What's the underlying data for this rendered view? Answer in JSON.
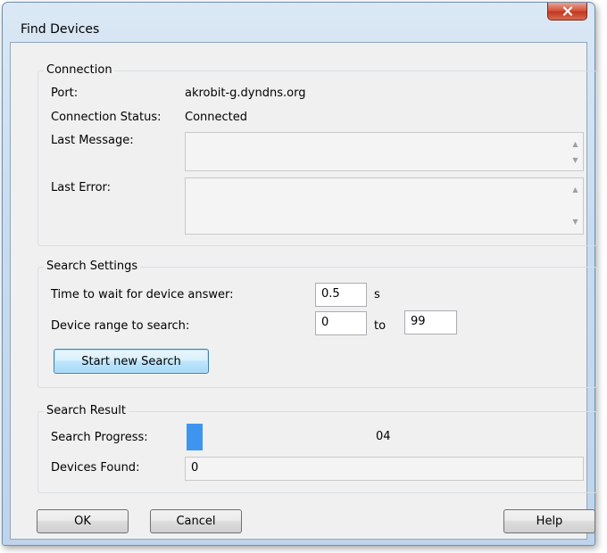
{
  "window": {
    "title": "Find Devices",
    "close_icon": "close-icon",
    "close_glyph": "X",
    "close_color": "#c2381f"
  },
  "connection": {
    "group_title": "Connection",
    "port_label": "Port:",
    "port_value": "akrobit-g.dyndns.org",
    "status_label": "Connection Status:",
    "status_value": "Connected",
    "last_message_label": "Last Message:",
    "last_message_value": "",
    "last_error_label": "Last Error:",
    "last_error_value": ""
  },
  "search_settings": {
    "group_title": "Search Settings",
    "wait_label": "Time to wait for device answer:",
    "wait_value": "0.5",
    "wait_unit": "s",
    "range_label": "Device range to search:",
    "range_from": "0",
    "range_to_label": "to",
    "range_to": "99",
    "start_button": "Start new Search"
  },
  "search_result": {
    "group_title": "Search Result",
    "progress_label": "Search Progress:",
    "progress_value": "04",
    "progress_fraction": 0.04,
    "progress_color": "#3d95f0",
    "devices_label": "Devices Found:",
    "devices_value": "0"
  },
  "buttons": {
    "ok": "OK",
    "cancel": "Cancel",
    "help": "Help"
  }
}
